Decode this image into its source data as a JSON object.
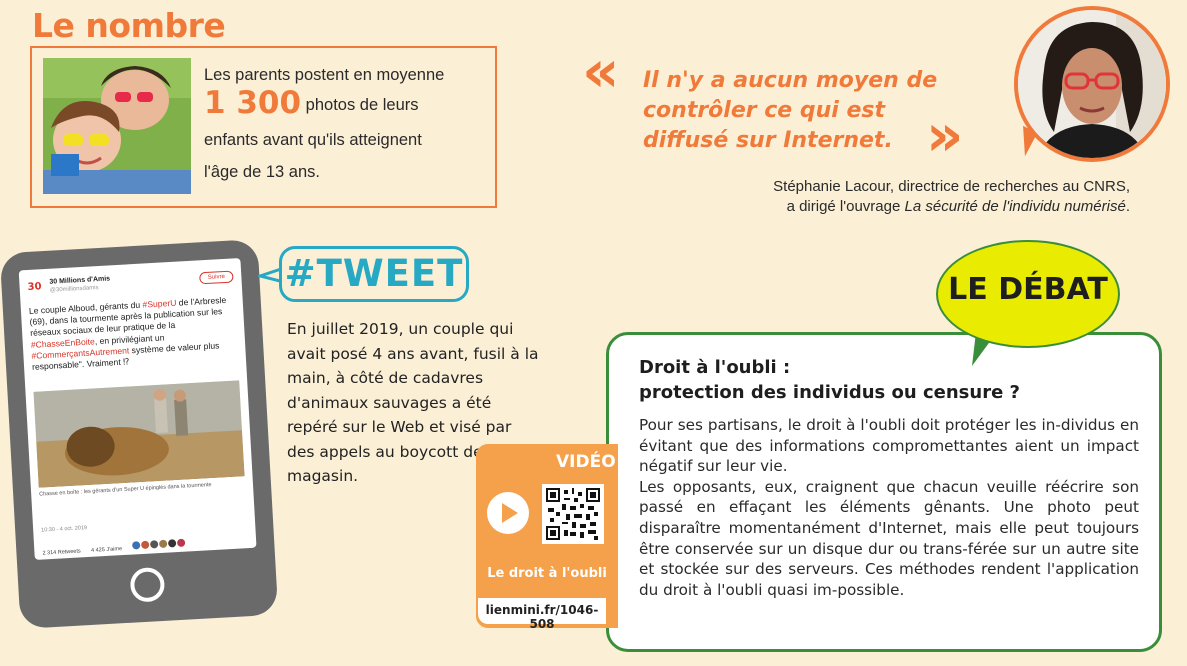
{
  "nombre": {
    "title": "Le nombre",
    "line1": "Les parents postent en moyenne",
    "highlight": "1 300",
    "line2": "photos de leurs",
    "line3": "enfants avant qu'ils atteignent",
    "line4": "l'âge de 13 ans."
  },
  "quote": {
    "open": "«",
    "close": "»",
    "text": "Il n'y a aucun moyen de contrôler ce qui est diffusé sur Internet.",
    "author_line1": "Stéphanie Lacour, directrice de recherches au CNRS,",
    "author_line2_prefix": "a dirigé l'ouvrage ",
    "author_line2_title": "La sécurité de l'individu numérisé",
    "author_line2_suffix": "."
  },
  "tweet_screen": {
    "account": "30 Millions d'Amis",
    "handle": "@30millionsdamis",
    "follow": "Suivre",
    "logo": "30",
    "body_1": "Le couple Alboud, gérants du ",
    "hash_1": "#SuperU",
    "body_2": " de l'Arbresle (69), dans la tourmente après la publication sur les réseaux sociaux de leur pratique de la ",
    "hash_2": "#ChasseEnBoite",
    "body_3": ", en privilégiant un ",
    "hash_3": "#CommerçantsAutrement",
    "body_4": " système de valeur plus responsable\". Vraiment ⁉",
    "caption": "Chasse en boîte : les gérants d'un Super U épinglés dans la tourmente",
    "meta": "10:30 - 4 oct. 2019",
    "stats_1": "2 314 Retweets",
    "stats_2": "4 425 J'aime"
  },
  "tweet": {
    "label": "#TWEET",
    "text": "En juillet 2019, un couple qui avait posé 4 ans avant, fusil à la main, à côté de cadavres d'animaux sauvages a été repéré sur le Web et visé par des appels au boycott de leur magasin."
  },
  "video": {
    "label": "VIDÉO",
    "caption": "Le droit à l'oubli",
    "link": "lienmini.fr/1046-508"
  },
  "debat": {
    "label": "LE DÉBAT",
    "title_line1": "Droit à l'oubli :",
    "title_line2": "protection des individus ou censure ?",
    "para1": "Pour ses partisans, le droit à l'oubli doit protéger les in-dividus en évitant que des informations compromettantes aient un impact négatif sur leur vie.",
    "para2": "Les opposants, eux, craignent que chacun veuille réécrire son passé en effaçant les éléments gênants. Une photo peut disparaître momentanément d'Internet, mais elle peut toujours être conservée sur un disque dur ou trans-férée sur un autre site et stockée sur des serveurs. Ces méthodes rendent l'application du droit à l'oubli quasi im-possible."
  },
  "colors": {
    "accent_orange": "#f07a3a",
    "tweet_blue": "#27a9c4",
    "debat_green": "#3a8e3a",
    "debat_yellow": "#e9ec00",
    "background": "#fbefd6"
  }
}
